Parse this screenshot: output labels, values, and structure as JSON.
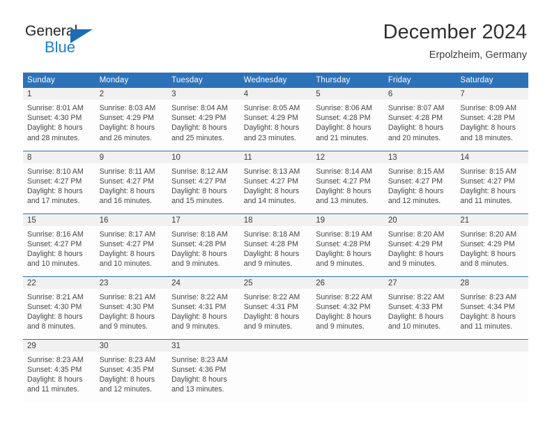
{
  "brand": {
    "name_part1": "General",
    "name_part2": "Blue",
    "triangle_icon": "triangle-icon",
    "accent_color": "#1b7fd4"
  },
  "header": {
    "title": "December 2024",
    "location": "Erpolzheim, Germany"
  },
  "theme": {
    "header_blue": "#2d72b8",
    "daynum_gray": "#f1f1f1",
    "cell_white": "#fdfdfd"
  },
  "calendar": {
    "weekday_headers": [
      "Sunday",
      "Monday",
      "Tuesday",
      "Wednesday",
      "Thursday",
      "Friday",
      "Saturday"
    ],
    "weeks": [
      [
        {
          "day": "1",
          "sunrise": "Sunrise: 8:01 AM",
          "sunset": "Sunset: 4:30 PM",
          "daylight_line1": "Daylight: 8 hours",
          "daylight_line2": "and 28 minutes."
        },
        {
          "day": "2",
          "sunrise": "Sunrise: 8:03 AM",
          "sunset": "Sunset: 4:29 PM",
          "daylight_line1": "Daylight: 8 hours",
          "daylight_line2": "and 26 minutes."
        },
        {
          "day": "3",
          "sunrise": "Sunrise: 8:04 AM",
          "sunset": "Sunset: 4:29 PM",
          "daylight_line1": "Daylight: 8 hours",
          "daylight_line2": "and 25 minutes."
        },
        {
          "day": "4",
          "sunrise": "Sunrise: 8:05 AM",
          "sunset": "Sunset: 4:29 PM",
          "daylight_line1": "Daylight: 8 hours",
          "daylight_line2": "and 23 minutes."
        },
        {
          "day": "5",
          "sunrise": "Sunrise: 8:06 AM",
          "sunset": "Sunset: 4:28 PM",
          "daylight_line1": "Daylight: 8 hours",
          "daylight_line2": "and 21 minutes."
        },
        {
          "day": "6",
          "sunrise": "Sunrise: 8:07 AM",
          "sunset": "Sunset: 4:28 PM",
          "daylight_line1": "Daylight: 8 hours",
          "daylight_line2": "and 20 minutes."
        },
        {
          "day": "7",
          "sunrise": "Sunrise: 8:09 AM",
          "sunset": "Sunset: 4:28 PM",
          "daylight_line1": "Daylight: 8 hours",
          "daylight_line2": "and 18 minutes."
        }
      ],
      [
        {
          "day": "8",
          "sunrise": "Sunrise: 8:10 AM",
          "sunset": "Sunset: 4:27 PM",
          "daylight_line1": "Daylight: 8 hours",
          "daylight_line2": "and 17 minutes."
        },
        {
          "day": "9",
          "sunrise": "Sunrise: 8:11 AM",
          "sunset": "Sunset: 4:27 PM",
          "daylight_line1": "Daylight: 8 hours",
          "daylight_line2": "and 16 minutes."
        },
        {
          "day": "10",
          "sunrise": "Sunrise: 8:12 AM",
          "sunset": "Sunset: 4:27 PM",
          "daylight_line1": "Daylight: 8 hours",
          "daylight_line2": "and 15 minutes."
        },
        {
          "day": "11",
          "sunrise": "Sunrise: 8:13 AM",
          "sunset": "Sunset: 4:27 PM",
          "daylight_line1": "Daylight: 8 hours",
          "daylight_line2": "and 14 minutes."
        },
        {
          "day": "12",
          "sunrise": "Sunrise: 8:14 AM",
          "sunset": "Sunset: 4:27 PM",
          "daylight_line1": "Daylight: 8 hours",
          "daylight_line2": "and 13 minutes."
        },
        {
          "day": "13",
          "sunrise": "Sunrise: 8:15 AM",
          "sunset": "Sunset: 4:27 PM",
          "daylight_line1": "Daylight: 8 hours",
          "daylight_line2": "and 12 minutes."
        },
        {
          "day": "14",
          "sunrise": "Sunrise: 8:15 AM",
          "sunset": "Sunset: 4:27 PM",
          "daylight_line1": "Daylight: 8 hours",
          "daylight_line2": "and 11 minutes."
        }
      ],
      [
        {
          "day": "15",
          "sunrise": "Sunrise: 8:16 AM",
          "sunset": "Sunset: 4:27 PM",
          "daylight_line1": "Daylight: 8 hours",
          "daylight_line2": "and 10 minutes."
        },
        {
          "day": "16",
          "sunrise": "Sunrise: 8:17 AM",
          "sunset": "Sunset: 4:27 PM",
          "daylight_line1": "Daylight: 8 hours",
          "daylight_line2": "and 10 minutes."
        },
        {
          "day": "17",
          "sunrise": "Sunrise: 8:18 AM",
          "sunset": "Sunset: 4:28 PM",
          "daylight_line1": "Daylight: 8 hours",
          "daylight_line2": "and 9 minutes."
        },
        {
          "day": "18",
          "sunrise": "Sunrise: 8:18 AM",
          "sunset": "Sunset: 4:28 PM",
          "daylight_line1": "Daylight: 8 hours",
          "daylight_line2": "and 9 minutes."
        },
        {
          "day": "19",
          "sunrise": "Sunrise: 8:19 AM",
          "sunset": "Sunset: 4:28 PM",
          "daylight_line1": "Daylight: 8 hours",
          "daylight_line2": "and 9 minutes."
        },
        {
          "day": "20",
          "sunrise": "Sunrise: 8:20 AM",
          "sunset": "Sunset: 4:29 PM",
          "daylight_line1": "Daylight: 8 hours",
          "daylight_line2": "and 9 minutes."
        },
        {
          "day": "21",
          "sunrise": "Sunrise: 8:20 AM",
          "sunset": "Sunset: 4:29 PM",
          "daylight_line1": "Daylight: 8 hours",
          "daylight_line2": "and 8 minutes."
        }
      ],
      [
        {
          "day": "22",
          "sunrise": "Sunrise: 8:21 AM",
          "sunset": "Sunset: 4:30 PM",
          "daylight_line1": "Daylight: 8 hours",
          "daylight_line2": "and 8 minutes."
        },
        {
          "day": "23",
          "sunrise": "Sunrise: 8:21 AM",
          "sunset": "Sunset: 4:30 PM",
          "daylight_line1": "Daylight: 8 hours",
          "daylight_line2": "and 9 minutes."
        },
        {
          "day": "24",
          "sunrise": "Sunrise: 8:22 AM",
          "sunset": "Sunset: 4:31 PM",
          "daylight_line1": "Daylight: 8 hours",
          "daylight_line2": "and 9 minutes."
        },
        {
          "day": "25",
          "sunrise": "Sunrise: 8:22 AM",
          "sunset": "Sunset: 4:31 PM",
          "daylight_line1": "Daylight: 8 hours",
          "daylight_line2": "and 9 minutes."
        },
        {
          "day": "26",
          "sunrise": "Sunrise: 8:22 AM",
          "sunset": "Sunset: 4:32 PM",
          "daylight_line1": "Daylight: 8 hours",
          "daylight_line2": "and 9 minutes."
        },
        {
          "day": "27",
          "sunrise": "Sunrise: 8:22 AM",
          "sunset": "Sunset: 4:33 PM",
          "daylight_line1": "Daylight: 8 hours",
          "daylight_line2": "and 10 minutes."
        },
        {
          "day": "28",
          "sunrise": "Sunrise: 8:23 AM",
          "sunset": "Sunset: 4:34 PM",
          "daylight_line1": "Daylight: 8 hours",
          "daylight_line2": "and 11 minutes."
        }
      ],
      [
        {
          "day": "29",
          "sunrise": "Sunrise: 8:23 AM",
          "sunset": "Sunset: 4:35 PM",
          "daylight_line1": "Daylight: 8 hours",
          "daylight_line2": "and 11 minutes."
        },
        {
          "day": "30",
          "sunrise": "Sunrise: 8:23 AM",
          "sunset": "Sunset: 4:35 PM",
          "daylight_line1": "Daylight: 8 hours",
          "daylight_line2": "and 12 minutes."
        },
        {
          "day": "31",
          "sunrise": "Sunrise: 8:23 AM",
          "sunset": "Sunset: 4:36 PM",
          "daylight_line1": "Daylight: 8 hours",
          "daylight_line2": "and 13 minutes."
        },
        {
          "day": "",
          "sunrise": "",
          "sunset": "",
          "daylight_line1": "",
          "daylight_line2": ""
        },
        {
          "day": "",
          "sunrise": "",
          "sunset": "",
          "daylight_line1": "",
          "daylight_line2": ""
        },
        {
          "day": "",
          "sunrise": "",
          "sunset": "",
          "daylight_line1": "",
          "daylight_line2": ""
        },
        {
          "day": "",
          "sunrise": "",
          "sunset": "",
          "daylight_line1": "",
          "daylight_line2": ""
        }
      ]
    ]
  }
}
